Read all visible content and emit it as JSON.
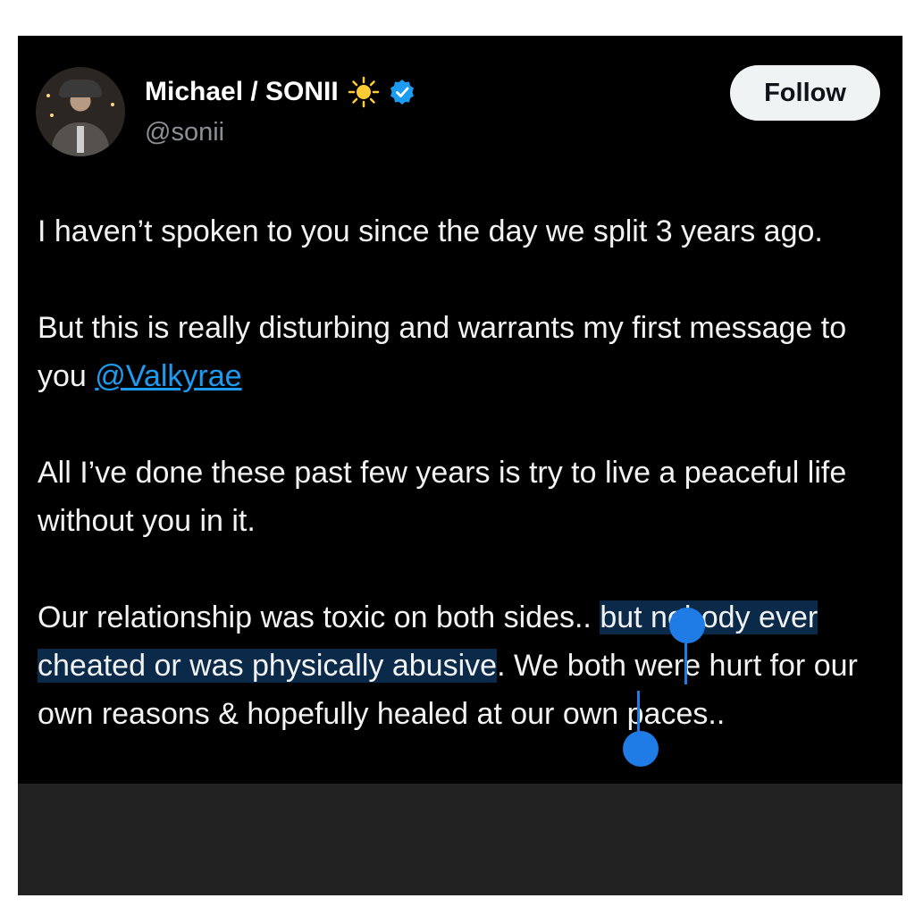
{
  "author": {
    "name": "Michael / SONII",
    "handle": "@sonii",
    "emoji_icon": "sun-icon",
    "verified_icon": "verified-badge-icon",
    "verified_color": "#1d9bf0"
  },
  "follow_button": {
    "label": "Follow"
  },
  "tweet": {
    "p1": "I haven’t spoken to you since the day we split 3 years ago.",
    "p2_text": "But this is really disturbing and warrants my first message to you ",
    "p2_mention": "@Valkyrae",
    "p3": "All I’ve done these past few years is try to live a peaceful life without you in it.",
    "p4_before": "Our relationship was toxic on both sides.. ",
    "p4_selected": "but nobody ever cheated or was physically abusive",
    "p4_after": ". We both were hurt for our own reasons & hopefully healed at our own paces.."
  },
  "colors": {
    "background": "#000000",
    "text": "#f2f2f2",
    "mention": "#1d9bf0",
    "selection": "#0b2a4a",
    "selection_handle": "#1f7be6"
  }
}
